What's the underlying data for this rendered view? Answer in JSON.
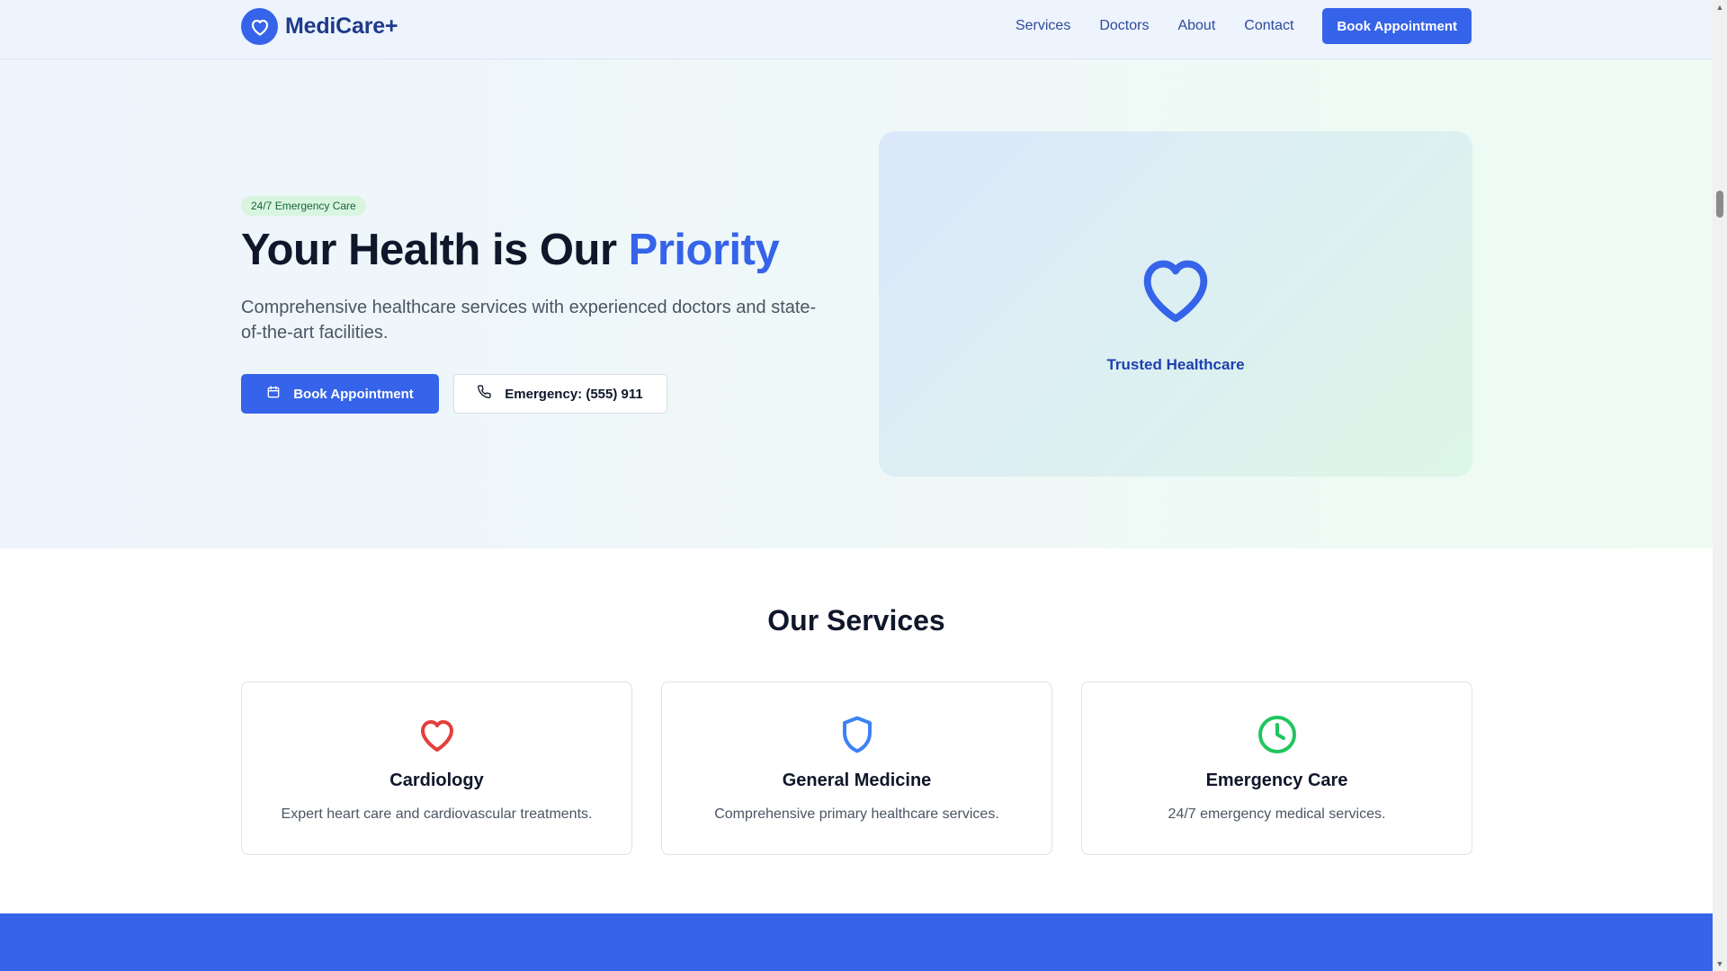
{
  "header": {
    "brand": "MediCare+",
    "nav": [
      "Services",
      "Doctors",
      "About",
      "Contact"
    ],
    "cta_label": "Book Appointment"
  },
  "hero": {
    "badge": "24/7 Emergency Care",
    "title_main": "Your Health is Our ",
    "title_accent": "Priority",
    "subtitle": "Comprehensive healthcare services with experienced doctors and state-of-the-art facilities.",
    "primary_button": "Book Appointment",
    "secondary_button": "Emergency: (555) 911",
    "card_label": "Trusted Healthcare"
  },
  "services": {
    "title": "Our Services",
    "items": [
      {
        "name": "Cardiology",
        "description": "Expert heart care and cardiovascular treatments.",
        "icon": "heart-icon",
        "color": "#e53e3e"
      },
      {
        "name": "General Medicine",
        "description": "Comprehensive primary healthcare services.",
        "icon": "shield-icon",
        "color": "#3b82f6"
      },
      {
        "name": "Emergency Care",
        "description": "24/7 emergency medical services.",
        "icon": "clock-icon",
        "color": "#22c55e"
      }
    ]
  },
  "colors": {
    "primary": "#3563e9",
    "brand_text": "#1e3a8a",
    "badge_bg": "#d8f5e0",
    "badge_text": "#166534"
  }
}
